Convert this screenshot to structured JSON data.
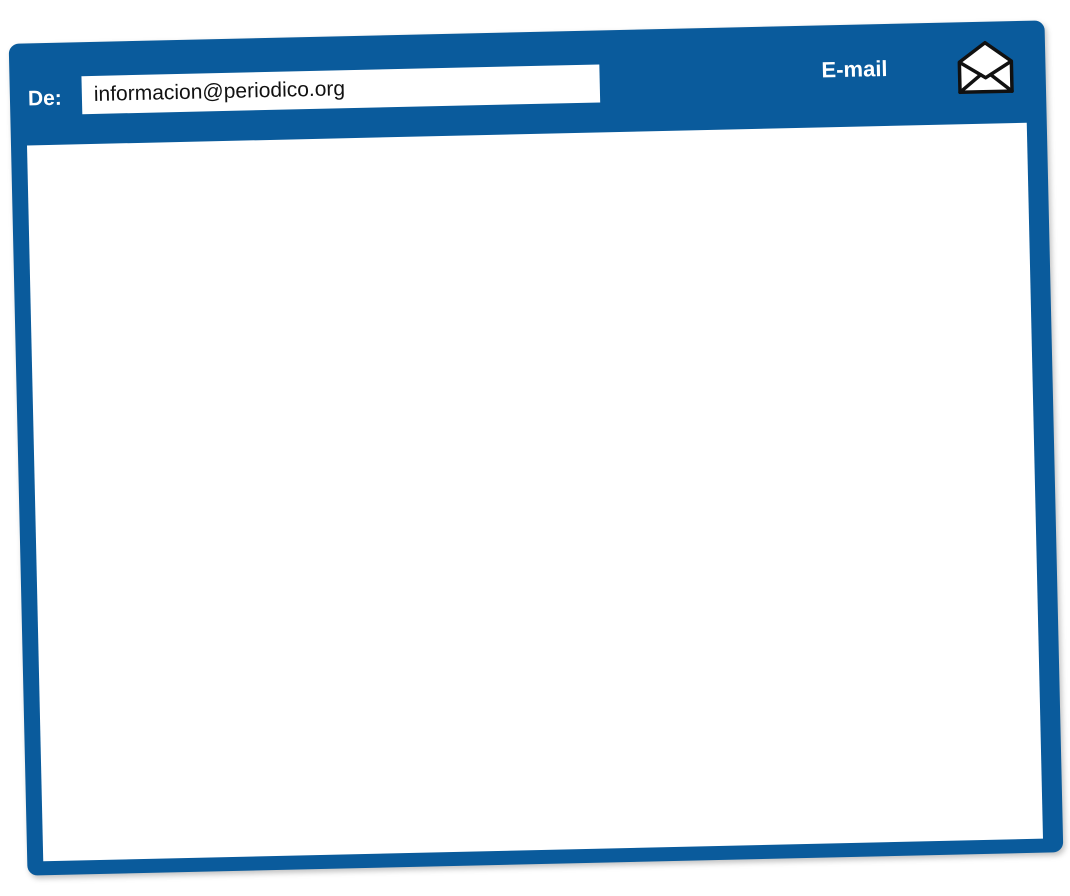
{
  "header": {
    "from_label": "De:",
    "from_value": "informacion@periodico.org",
    "title": "E-mail",
    "icon": "envelope-icon"
  },
  "message": {
    "body": ""
  },
  "colors": {
    "frame": "#0a5b9c",
    "text": "#ffffff",
    "body": "#ffffff"
  }
}
